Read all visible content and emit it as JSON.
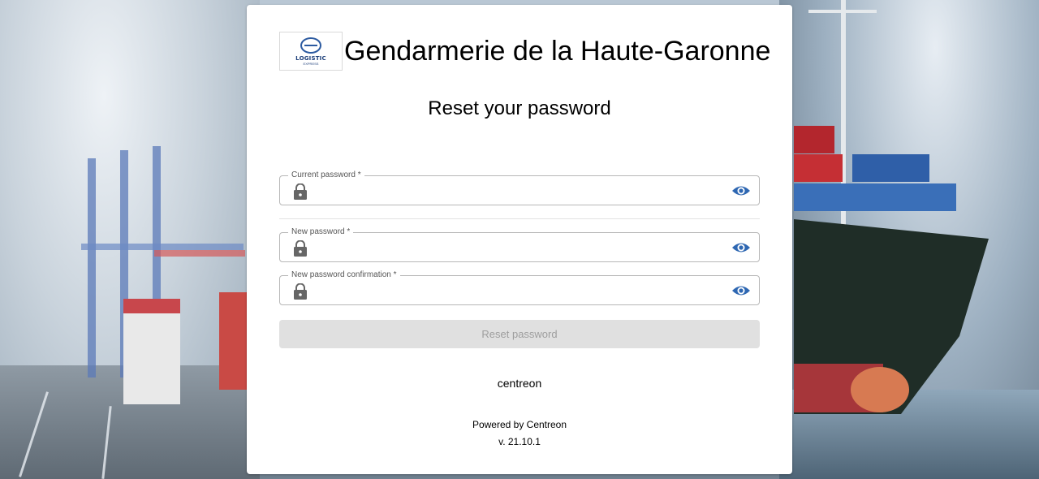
{
  "brand": {
    "platform_name": "Gendarmerie de la Haute-Garonne",
    "logo_text": "LOGISTIC",
    "logo_subtext": "EXPRESS"
  },
  "page": {
    "title": "Reset your password"
  },
  "form": {
    "fields": [
      {
        "label": "Current password *",
        "value": "",
        "icon": "lock-icon",
        "toggle_icon": "eye-icon"
      },
      {
        "label": "New password *",
        "value": "",
        "icon": "lock-icon",
        "toggle_icon": "eye-icon"
      },
      {
        "label": "New password confirmation *",
        "value": "",
        "icon": "lock-icon",
        "toggle_icon": "eye-icon"
      }
    ],
    "submit_label": "Reset password",
    "submit_enabled": false
  },
  "footer": {
    "brand": "centreon",
    "powered_by": "Powered by Centreon",
    "version": "v. 21.10.1"
  },
  "colors": {
    "accent": "#2e67b2",
    "icon_grey": "#666666",
    "disabled_button_bg": "#e0e0e0",
    "disabled_button_text": "#9e9e9e"
  }
}
